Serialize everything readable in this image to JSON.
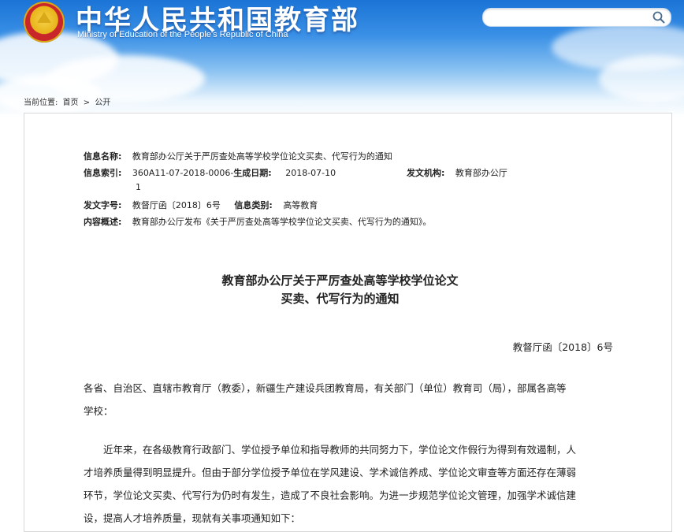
{
  "header": {
    "title": "中华人民共和国教育部",
    "subtitle": "Ministry of Education of the People's Republic of China",
    "search_placeholder": ""
  },
  "breadcrumb": {
    "prefix": "当前位置:",
    "home": "首页",
    "sep": ">",
    "current": "公开"
  },
  "meta": {
    "name_label": "信息名称:",
    "name_value": "教育部办公厅关于严厉查处高等学校学位论文买卖、代写行为的通知",
    "index_label": "信息索引:",
    "index_value": "360A11-07-2018-0006-",
    "index_value_cont": "1",
    "date_label": "生成日期:",
    "date_value": "2018-07-10",
    "org_label": "发文机构:",
    "org_value": "教育部办公厅",
    "docno_label": "发文字号:",
    "docno_value": "教督厅函〔2018〕6号",
    "category_label": "信息类别:",
    "category_value": "高等教育",
    "summary_label": "内容概述:",
    "summary_value": "教育部办公厅发布《关于严厉查处高等学校学位论文买卖、代写行为的通知》。"
  },
  "document": {
    "title_line1": "教育部办公厅关于严厉查处高等学校学位论文",
    "title_line2": "买卖、代写行为的通知",
    "doc_number": "教督厅函〔2018〕6号",
    "salutation_line1": "各省、自治区、直辖市教育厅（教委），新疆生产建设兵团教育局，有关部门（单位）教育司（局），部属各高等",
    "salutation_line2": "学校：",
    "para1_line1": "近年来，在各级教育行政部门、学位授予单位和指导教师的共同努力下，学位论文作假行为得到有效遏制，人",
    "para1_line2": "才培养质量得到明显提升。但由于部分学位授予单位在学风建设、学术诚信养成、学位论文审查等方面还存在薄弱",
    "para1_line3": "环节，学位论文买卖、代写行为仍时有发生，造成了不良社会影响。为进一步规范学位论文管理，加强学术诚信建",
    "para1_line4": "设，提高人才培养质量，现就有关事项通知如下："
  }
}
